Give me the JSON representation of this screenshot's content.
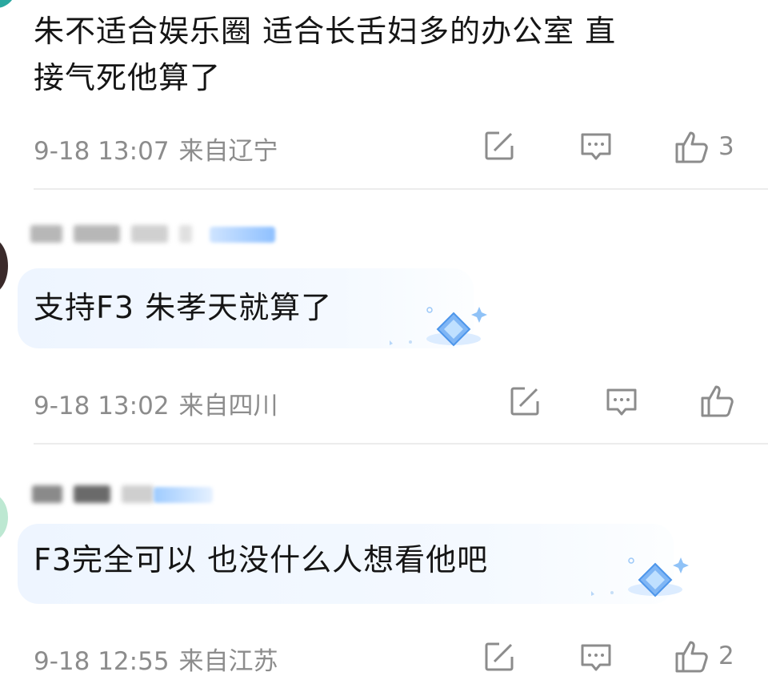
{
  "comments": [
    {
      "text_lines": [
        "朱不适合娱乐圈 适合长舌妇多的办公室 直",
        "接气死他算了"
      ],
      "time": "9-18 13:07",
      "location": "来自辽宁",
      "like_count": "3"
    },
    {
      "text_lines": [
        "支持F3 朱孝天就算了"
      ],
      "time": "9-18 13:02",
      "location": "来自四川",
      "like_count": ""
    },
    {
      "text_lines": [
        "F3完全可以  也没什么人想看他吧"
      ],
      "time": "9-18 12:55",
      "location": "来自江苏",
      "like_count": "2"
    }
  ],
  "icons": {
    "repost": "repost-icon",
    "comment": "comment-icon",
    "like": "like-icon",
    "bubble_decor": "diamond-gem-icon"
  },
  "colors": {
    "text": "#151515",
    "meta": "#8c8c8c",
    "bubble": "#eef5ff",
    "divider": "#ececec",
    "gem": "#5aa2f5"
  }
}
